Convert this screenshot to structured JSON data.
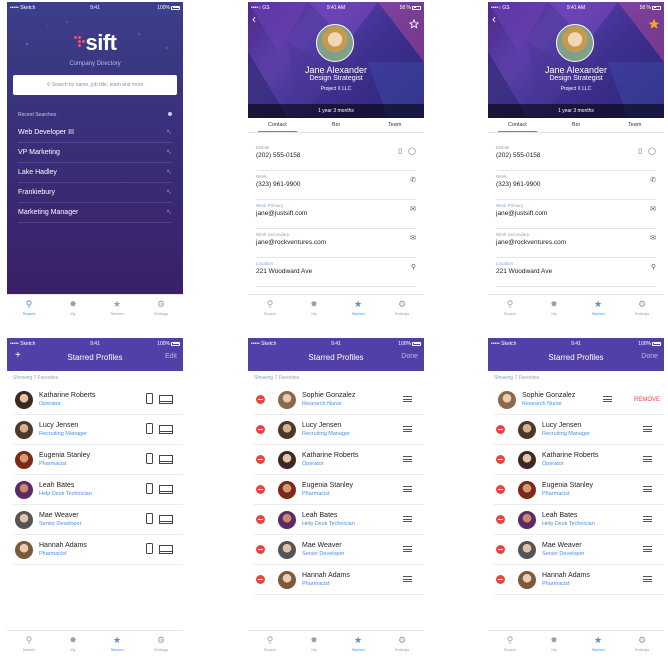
{
  "tabbar": [
    {
      "label": "Search",
      "icon": "search-icon"
    },
    {
      "label": "My",
      "icon": "network-icon"
    },
    {
      "label": "Starred",
      "icon": "star-icon"
    },
    {
      "label": "Settings",
      "icon": "gear-icon"
    }
  ],
  "search_screen": {
    "status": {
      "carrier": "••••• Sketch",
      "time": "9:41",
      "battery": "100%"
    },
    "logo": "sift",
    "subtitle": "Company Directory",
    "search_placeholder": "Search by name, job title, team and more",
    "recent_header": "Recent Searches",
    "recent": [
      "Web Developer III",
      "VP Marketing",
      "Lake Hadley",
      "Frankiebury",
      "Marketing Manager"
    ]
  },
  "profile": {
    "status": {
      "carrier": "••••○ GS",
      "time": "9:41 AM",
      "battery": "58 %"
    },
    "name": "Jane Alexander",
    "role": "Design Strategist",
    "project": "Project X LLC",
    "tenure": "1 year 3 months",
    "tabs": [
      "Contact",
      "Bio",
      "Team"
    ],
    "fields": [
      {
        "label": "Mobile",
        "value": "(202) 555-0158"
      },
      {
        "label": "Work",
        "value": "(323) 961-9900"
      },
      {
        "label": "Work Primary",
        "value": "jane@justsift.com"
      },
      {
        "label": "Work Secondary",
        "value": "jane@rockventures.com"
      },
      {
        "label": "Location",
        "value": "221 Woodward Ave"
      }
    ],
    "star_colors": {
      "outline": "#ffffff",
      "filled": "#f5a623"
    }
  },
  "starred": {
    "status_s4": {
      "carrier": "••••• Sketch",
      "time": "9:41",
      "battery": "100%"
    },
    "status_s5": {
      "carrier": "••••• Sketch",
      "time": "9:41",
      "battery": "100%"
    },
    "status_s6": {
      "carrier": "••••• Sketch",
      "time": "9:41",
      "battery": "100%"
    },
    "title": "Starred Profiles",
    "add": "+",
    "edit": "Edit",
    "done": "Done",
    "showing": "Showing 7 Favorites",
    "remove": "REMOVE",
    "list_view": [
      {
        "name": "Katharine Roberts",
        "role": "Operator"
      },
      {
        "name": "Lucy Jensen",
        "role": "Recruiting Manager"
      },
      {
        "name": "Eugenia Stanley",
        "role": "Pharmacist"
      },
      {
        "name": "Leah Bates",
        "role": "Help Desk Technician"
      },
      {
        "name": "Mae Weaver",
        "role": "Senior Developer"
      },
      {
        "name": "Hannah Adams",
        "role": "Pharmacist"
      }
    ],
    "edit_view": [
      {
        "name": "Sophie Gonzalez",
        "role": "Research Nurse"
      },
      {
        "name": "Lucy Jensen",
        "role": "Recruiting Manager"
      },
      {
        "name": "Katharine Roberts",
        "role": "Operator"
      },
      {
        "name": "Eugenia Stanley",
        "role": "Pharmacist"
      },
      {
        "name": "Leah Bates",
        "role": "Help Desk Technician"
      },
      {
        "name": "Mae Weaver",
        "role": "Senior Developer"
      },
      {
        "name": "Hannah Adams",
        "role": "Pharmacist"
      }
    ]
  },
  "colors": {
    "accent": "#4a90e2",
    "nav": "#5240a8",
    "delete": "#e8443e"
  }
}
